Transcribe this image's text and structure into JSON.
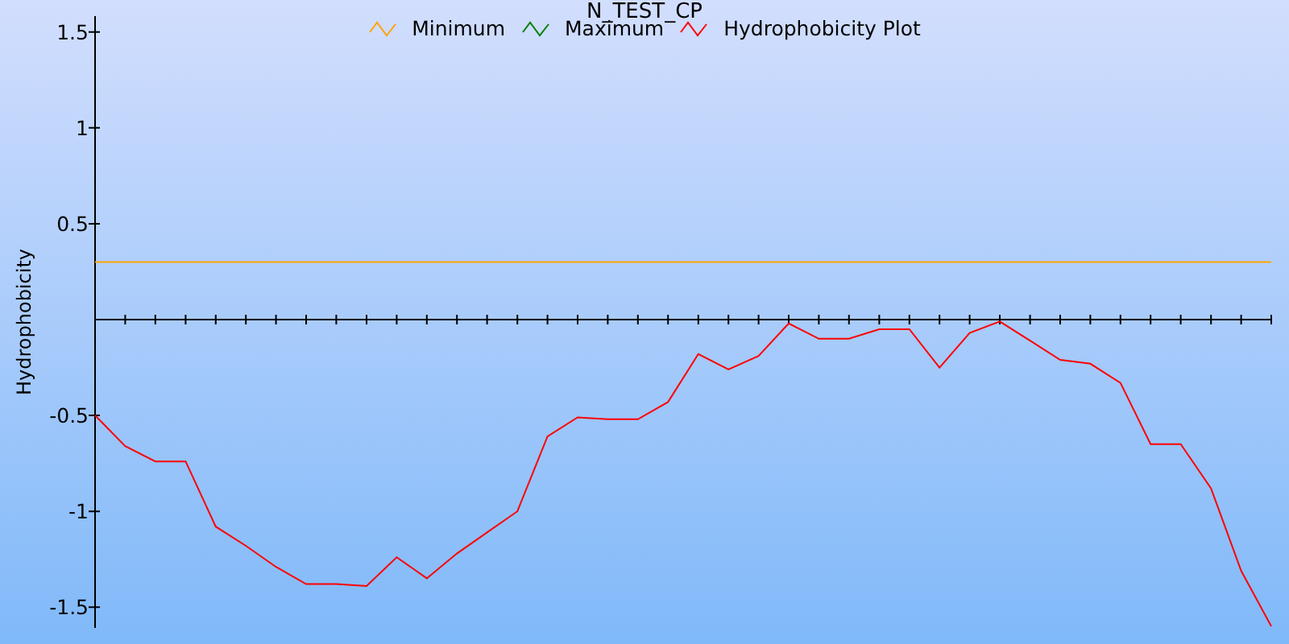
{
  "chart_data": {
    "type": "line",
    "title": "N_TEST_CP",
    "ylabel": "Hydrophobicity",
    "categories": [
      null,
      null,
      null,
      null,
      null,
      null,
      null,
      null,
      null,
      null,
      null,
      null,
      null,
      null,
      null,
      null,
      null,
      null,
      null,
      null,
      null,
      null,
      null,
      null,
      null,
      null,
      null,
      null,
      null,
      null,
      null,
      null,
      null,
      null,
      null,
      null,
      null,
      null,
      null,
      null
    ],
    "ylim": [
      -1.6,
      1.6
    ],
    "yticks": [
      -1.5,
      -1,
      -0.5,
      0.5,
      1,
      1.5
    ],
    "series": [
      {
        "name": "Minimum",
        "color": "#ffa500",
        "values": [
          0.3,
          0.3,
          0.3,
          0.3,
          0.3,
          0.3,
          0.3,
          0.3,
          0.3,
          0.3,
          0.3,
          0.3,
          0.3,
          0.3,
          0.3,
          0.3,
          0.3,
          0.3,
          0.3,
          0.3,
          0.3,
          0.3,
          0.3,
          0.3,
          0.3,
          0.3,
          0.3,
          0.3,
          0.3,
          0.3,
          0.3,
          0.3,
          0.3,
          0.3,
          0.3,
          0.3,
          0.3,
          0.3,
          0.3,
          0.3
        ]
      },
      {
        "name": "Maximum",
        "color": "#008000",
        "values": [
          null,
          null,
          null,
          null,
          null,
          null,
          null,
          null,
          null,
          null,
          null,
          null,
          null,
          null,
          null,
          null,
          null,
          null,
          null,
          null,
          null,
          null,
          null,
          null,
          null,
          null,
          null,
          null,
          null,
          null,
          null,
          null,
          null,
          null,
          null,
          null,
          null,
          null,
          null,
          null
        ]
      },
      {
        "name": "Hydrophobicity Plot",
        "color": "#ff0000",
        "values": [
          -0.5,
          -0.66,
          -0.74,
          -0.74,
          -1.08,
          -1.18,
          -1.29,
          -1.38,
          -1.38,
          -1.39,
          -1.24,
          -1.35,
          -1.22,
          -1.11,
          -1.0,
          -0.61,
          -0.51,
          -0.52,
          -0.52,
          -0.43,
          -0.18,
          -0.26,
          -0.19,
          -0.02,
          -0.1,
          -0.1,
          -0.05,
          -0.05,
          -0.25,
          -0.07,
          -0.01,
          -0.11,
          -0.21,
          -0.23,
          -0.33,
          -0.65,
          -0.65,
          -0.88,
          -1.31,
          -1.6
        ]
      }
    ]
  }
}
